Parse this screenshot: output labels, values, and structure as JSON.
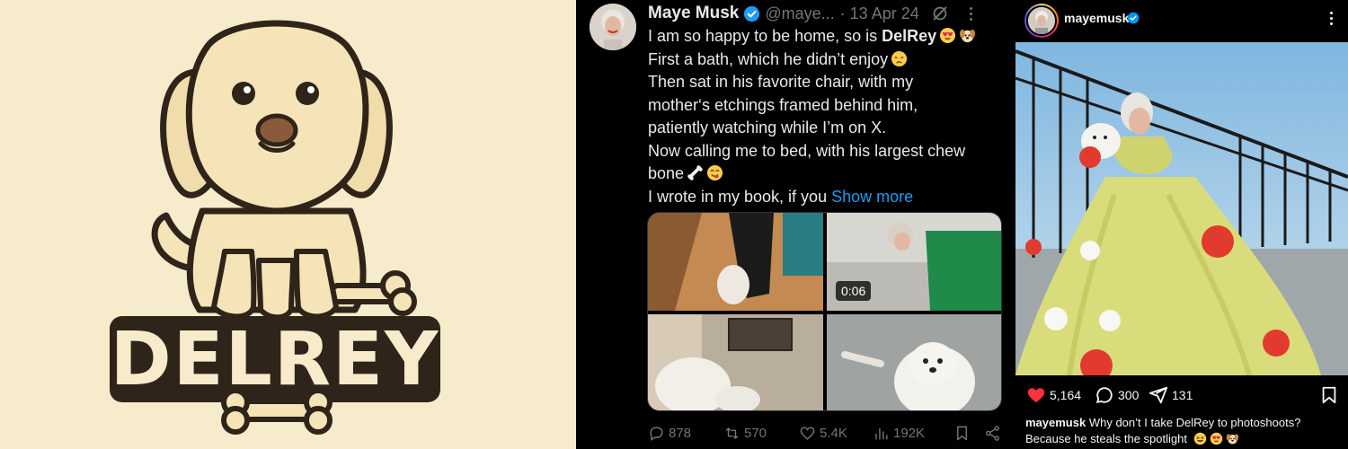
{
  "logo": {
    "wordmark": "DELREY",
    "colors": {
      "background": "#f6ebcb",
      "outline": "#2e2419",
      "fur": "#f4e4b8",
      "badge": "#2e2419",
      "nose": "#8b5a3c"
    }
  },
  "tweet": {
    "author_name": "Maye Musk",
    "handle": "@maye...",
    "date": "· 13 Apr 24",
    "body_lines": [
      {
        "parts": [
          "I am so happy to be home, so is ",
          "DelRey"
        ],
        "emojis": [
          "heart-eyes-emoji",
          "dog-face-emoji"
        ]
      },
      {
        "parts": [
          "First a bath, which he didn’t enjoy"
        ],
        "emojis": [
          "disappointed-face-emoji"
        ]
      },
      {
        "parts": [
          "Then sat in his favorite chair, with my"
        ]
      },
      {
        "parts": [
          "mother‘s etchings framed behind him,"
        ]
      },
      {
        "parts": [
          "patiently watching while I’m on X."
        ]
      },
      {
        "parts": [
          "Now calling me to bed, with his largest chew"
        ]
      },
      {
        "parts": [
          "bone"
        ],
        "emojis": [
          "bone-emoji",
          "yum-face-emoji"
        ]
      },
      {
        "parts": [
          "I wrote in my book, if you "
        ]
      }
    ],
    "show_more": "Show more",
    "video_duration": "0:06",
    "replies": "878",
    "reposts": "570",
    "likes": "5.4K",
    "views": "192K",
    "icons": [
      "verified-badge-icon",
      "grok-icon",
      "more-icon",
      "reply-icon",
      "repost-icon",
      "like-icon",
      "views-icon",
      "bookmark-icon",
      "share-icon"
    ]
  },
  "instagram": {
    "username": "mayemusk",
    "likes": "5,164",
    "comments": "300",
    "shares": "131",
    "caption_user": "mayemusk",
    "caption_line1": "Why don’t I take DelRey to photoshoots?",
    "caption_line2": "Because he steals the spotlight",
    "caption_emojis": [
      "squint-laugh-emoji",
      "heart-eyes-emoji",
      "dog-face-emoji"
    ],
    "colors": {
      "like": "#ff3040",
      "background": "#000000"
    }
  }
}
